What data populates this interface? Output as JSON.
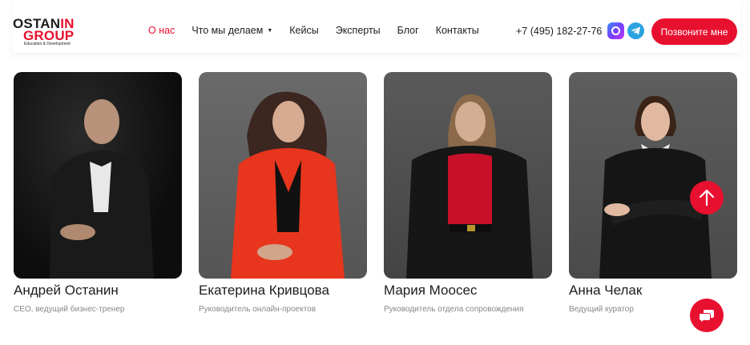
{
  "logo": {
    "line1_dark": "OSTAN",
    "line1_red": "IN",
    "line2": "GROUP",
    "tagline": "Education & Development"
  },
  "nav": {
    "items": [
      {
        "label": "О нас",
        "active": true
      },
      {
        "label": "Что мы делаем",
        "has_dropdown": true
      },
      {
        "label": "Кейсы"
      },
      {
        "label": "Эксперты"
      },
      {
        "label": "Блог"
      },
      {
        "label": "Контакты"
      }
    ]
  },
  "header": {
    "phone": "+7 (495) 182-27-76",
    "call_button": "Позвоните мне"
  },
  "team": [
    {
      "name": "Андрей Останин",
      "role": "CEO, ведущий бизнес-тренер",
      "photo_bg": "#141414",
      "accent": "#1b1b1b"
    },
    {
      "name": "Екатерина Кривцова",
      "role": "Руководитель онлайн-проектов",
      "photo_bg": "#595959",
      "accent": "#e8351d"
    },
    {
      "name": "Мария Моосес",
      "role": "Руководитель отдела сопровождения",
      "photo_bg": "#4d4d4d",
      "accent": "#c8102b"
    },
    {
      "name": "Анна Челак",
      "role": "Ведущий куратор",
      "photo_bg": "#5a5a5a",
      "accent": "#151515"
    }
  ],
  "colors": {
    "brand_red": "#e8102f",
    "telegram_blue": "#2aa3e0"
  },
  "icons": {
    "scroll_up": "arrow-up-icon",
    "chat": "chat-icon",
    "messenger": "max-messenger-icon",
    "telegram": "telegram-icon"
  }
}
